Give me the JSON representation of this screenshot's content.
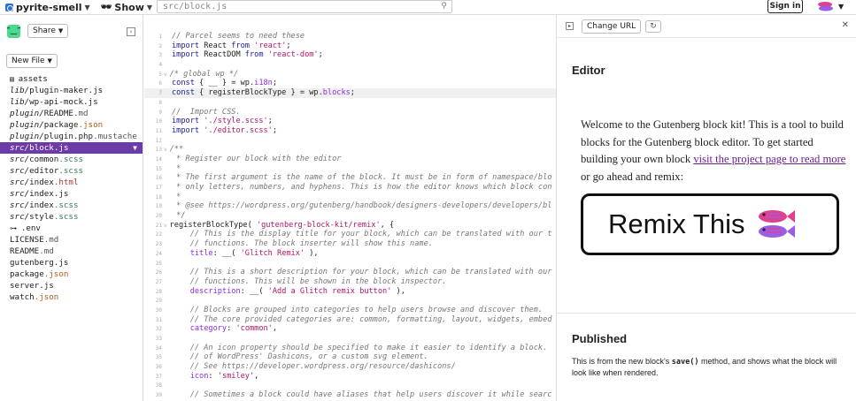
{
  "topbar": {
    "project_name": "pyrite-smell",
    "show_label": "Show",
    "search_value": "src/block.js",
    "signin_label": "Sign in"
  },
  "sidebar": {
    "share_label": "Share",
    "new_file_label": "New File",
    "files": [
      {
        "dir": "",
        "name": "assets",
        "ext": "",
        "icon": "folder-icon"
      },
      {
        "dir": "lib/",
        "name": "plugin-maker",
        "ext": ".js"
      },
      {
        "dir": "lib/",
        "name": "wp-api-mock",
        "ext": ".js"
      },
      {
        "dir": "plugin/",
        "name": "README",
        "ext": ".md"
      },
      {
        "dir": "plugin/",
        "name": "package",
        "ext": ".json"
      },
      {
        "dir": "plugin/",
        "name": "plugin.php",
        "ext": ".mustache"
      },
      {
        "dir": "src/",
        "name": "block",
        "ext": ".js",
        "active": true
      },
      {
        "dir": "src/",
        "name": "common",
        "ext": ".scss"
      },
      {
        "dir": "src/",
        "name": "editor",
        "ext": ".scss"
      },
      {
        "dir": "src/",
        "name": "index",
        "ext": ".html"
      },
      {
        "dir": "src/",
        "name": "index",
        "ext": ".js"
      },
      {
        "dir": "src/",
        "name": "index",
        "ext": ".scss"
      },
      {
        "dir": "src/",
        "name": "style",
        "ext": ".scss"
      },
      {
        "dir": "",
        "name": ".env",
        "ext": "",
        "icon": "key-icon"
      },
      {
        "dir": "",
        "name": "LICENSE",
        "ext": ".md"
      },
      {
        "dir": "",
        "name": "README",
        "ext": ".md"
      },
      {
        "dir": "",
        "name": "gutenberg",
        "ext": ".js"
      },
      {
        "dir": "",
        "name": "package",
        "ext": ".json"
      },
      {
        "dir": "",
        "name": "server",
        "ext": ".js"
      },
      {
        "dir": "",
        "name": "watch",
        "ext": ".json"
      }
    ]
  },
  "editor": {
    "lines": [
      {
        "n": "1",
        "fold": "",
        "tokens": [
          [
            "c",
            "// Parcel seems to need these"
          ]
        ]
      },
      {
        "n": "2",
        "fold": "",
        "tokens": [
          [
            "k",
            "import"
          ],
          [
            "",
            " React "
          ],
          [
            "k",
            "from"
          ],
          [
            "",
            " "
          ],
          [
            "s",
            "'react'"
          ],
          [
            "",
            ";"
          ]
        ]
      },
      {
        "n": "3",
        "fold": "",
        "tokens": [
          [
            "k",
            "import"
          ],
          [
            "",
            " ReactDOM "
          ],
          [
            "k",
            "from"
          ],
          [
            "",
            " "
          ],
          [
            "s",
            "'react-dom'"
          ],
          [
            "",
            ";"
          ]
        ]
      },
      {
        "n": "4",
        "fold": "",
        "tokens": []
      },
      {
        "n": "5",
        "fold": "v",
        "tokens": [
          [
            "c",
            "/* global wp */"
          ]
        ]
      },
      {
        "n": "6",
        "fold": "",
        "tokens": [
          [
            "k",
            "const"
          ],
          [
            "",
            " { __ } = wp."
          ],
          [
            "p",
            "i18n"
          ],
          [
            "",
            ";"
          ]
        ]
      },
      {
        "n": "7",
        "fold": "",
        "hl": true,
        "tokens": [
          [
            "k",
            "const"
          ],
          [
            "",
            " { registerBlockType } = wp."
          ],
          [
            "p",
            "blocks"
          ],
          [
            "",
            ";"
          ]
        ]
      },
      {
        "n": "8",
        "fold": "",
        "tokens": []
      },
      {
        "n": "9",
        "fold": "",
        "tokens": [
          [
            "c",
            "//  Import CSS."
          ]
        ]
      },
      {
        "n": "10",
        "fold": "",
        "tokens": [
          [
            "k",
            "import"
          ],
          [
            "",
            " "
          ],
          [
            "s",
            "'./style.scss'"
          ],
          [
            "",
            ";"
          ]
        ]
      },
      {
        "n": "11",
        "fold": "",
        "tokens": [
          [
            "k",
            "import"
          ],
          [
            "",
            " "
          ],
          [
            "s",
            "'./editor.scss'"
          ],
          [
            "",
            ";"
          ]
        ]
      },
      {
        "n": "12",
        "fold": "",
        "tokens": []
      },
      {
        "n": "13",
        "fold": "v",
        "tokens": [
          [
            "c",
            "/**"
          ]
        ]
      },
      {
        "n": "14",
        "fold": "",
        "tokens": [
          [
            "c",
            " * Register our block with the editor"
          ]
        ]
      },
      {
        "n": "15",
        "fold": "",
        "tokens": [
          [
            "c",
            " *"
          ]
        ]
      },
      {
        "n": "16",
        "fold": "",
        "tokens": [
          [
            "c",
            " * The first argument is the name of the block. It must be in form of namespace/blo"
          ]
        ]
      },
      {
        "n": "17",
        "fold": "",
        "tokens": [
          [
            "c",
            " * only letters, numbers, and hyphens. This is how the editor knows which block con"
          ]
        ]
      },
      {
        "n": "18",
        "fold": "",
        "tokens": [
          [
            "c",
            " *"
          ]
        ]
      },
      {
        "n": "19",
        "fold": "",
        "tokens": [
          [
            "c",
            " * @see https://wordpress.org/gutenberg/handbook/designers-developers/developers/bl"
          ]
        ]
      },
      {
        "n": "20",
        "fold": "",
        "tokens": [
          [
            "c",
            " */"
          ]
        ]
      },
      {
        "n": "21",
        "fold": "v",
        "tokens": [
          [
            "",
            "registerBlockType( "
          ],
          [
            "s",
            "'gutenberg-block-kit/remix'"
          ],
          [
            "",
            ", {"
          ]
        ]
      },
      {
        "n": "22",
        "fold": "",
        "tokens": [
          [
            "c",
            "    // This is the display title for your block, which can be translated with our t"
          ]
        ]
      },
      {
        "n": "23",
        "fold": "",
        "tokens": [
          [
            "c",
            "    // functions. The block inserter will show this name."
          ]
        ]
      },
      {
        "n": "24",
        "fold": "",
        "tokens": [
          [
            "",
            "    "
          ],
          [
            "p",
            "title"
          ],
          [
            "",
            ": __( "
          ],
          [
            "s",
            "'Glitch Remix'"
          ],
          [
            "",
            " ),"
          ]
        ]
      },
      {
        "n": "25",
        "fold": "",
        "tokens": []
      },
      {
        "n": "26",
        "fold": "",
        "tokens": [
          [
            "c",
            "    // This is a short description for your block, which can be translated with our"
          ]
        ]
      },
      {
        "n": "27",
        "fold": "",
        "tokens": [
          [
            "c",
            "    // functions. This will be shown in the block inspector."
          ]
        ]
      },
      {
        "n": "28",
        "fold": "",
        "tokens": [
          [
            "",
            "    "
          ],
          [
            "p",
            "description"
          ],
          [
            "",
            ": __( "
          ],
          [
            "s",
            "'Add a Glitch remix button'"
          ],
          [
            "",
            " ),"
          ]
        ]
      },
      {
        "n": "29",
        "fold": "",
        "tokens": []
      },
      {
        "n": "30",
        "fold": "",
        "tokens": [
          [
            "c",
            "    // Blocks are grouped into categories to help users browse and discover them."
          ]
        ]
      },
      {
        "n": "31",
        "fold": "",
        "tokens": [
          [
            "c",
            "    // The core provided categories are: common, formatting, layout, widgets, embed"
          ]
        ]
      },
      {
        "n": "32",
        "fold": "",
        "tokens": [
          [
            "",
            "    "
          ],
          [
            "p",
            "category"
          ],
          [
            "",
            ": "
          ],
          [
            "s",
            "'common'"
          ],
          [
            "",
            ","
          ]
        ]
      },
      {
        "n": "33",
        "fold": "",
        "tokens": []
      },
      {
        "n": "34",
        "fold": "",
        "tokens": [
          [
            "c",
            "    // An icon property should be specified to make it easier to identify a block."
          ]
        ]
      },
      {
        "n": "35",
        "fold": "",
        "tokens": [
          [
            "c",
            "    // of WordPress' Dashicons, or a custom svg element."
          ]
        ]
      },
      {
        "n": "36",
        "fold": "",
        "tokens": [
          [
            "c",
            "    // See https://developer.wordpress.org/resource/dashicons/"
          ]
        ]
      },
      {
        "n": "37",
        "fold": "",
        "tokens": [
          [
            "",
            "    "
          ],
          [
            "p",
            "icon"
          ],
          [
            "",
            ": "
          ],
          [
            "s",
            "'smiley'"
          ],
          [
            "",
            ","
          ]
        ]
      },
      {
        "n": "38",
        "fold": "",
        "tokens": []
      },
      {
        "n": "39",
        "fold": "",
        "tokens": [
          [
            "c",
            "    // Sometimes a block could have aliases that help users discover it while searc"
          ]
        ]
      }
    ]
  },
  "preview": {
    "change_url_label": "Change URL",
    "editor_heading": "Editor",
    "intro_before": "Welcome to the Gutenberg block kit! This is a tool to build blocks for the Gutenberg block editor. To get started building your own block ",
    "intro_link": "visit the project page to read more",
    "intro_after": " or go ahead and remix:",
    "remix_label": "Remix This",
    "published_heading": "Published",
    "published_before": "This is from the new block's ",
    "published_code": "save()",
    "published_after": " method, and shows what the block will look like when rendered."
  },
  "colors": {
    "accent": "#6d3ba8",
    "link": "#6a1f8e",
    "smiley": "#4cd88f"
  }
}
